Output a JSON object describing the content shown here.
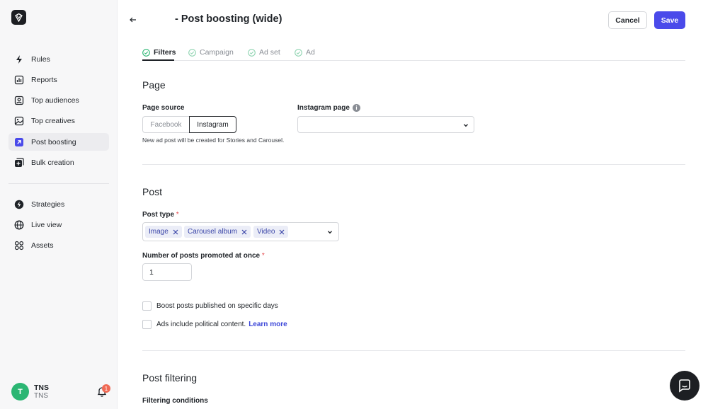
{
  "sidebar": {
    "items": [
      {
        "label": "Rules",
        "icon": "lightning-icon"
      },
      {
        "label": "Reports",
        "icon": "bar-chart-icon"
      },
      {
        "label": "Top audiences",
        "icon": "person-card-icon"
      },
      {
        "label": "Top creatives",
        "icon": "image-icon"
      },
      {
        "label": "Post boosting",
        "icon": "arrow-up-right-icon",
        "active": true
      },
      {
        "label": "Bulk creation",
        "icon": "stack-plus-icon"
      },
      {
        "label": "Strategies",
        "icon": "bolt-circle-icon"
      },
      {
        "label": "Live view",
        "icon": "globe-icon"
      },
      {
        "label": "Assets",
        "icon": "grid-icon"
      }
    ],
    "user": {
      "initial": "T",
      "name": "TNS",
      "sub": "TNS"
    },
    "notifications_count": "1"
  },
  "header": {
    "title": "- Post boosting (wide)",
    "cancel_label": "Cancel",
    "save_label": "Save"
  },
  "tabs": [
    {
      "label": "Filters",
      "active": true
    },
    {
      "label": "Campaign",
      "active": false
    },
    {
      "label": "Ad set",
      "active": false
    },
    {
      "label": "Ad",
      "active": false
    }
  ],
  "page_section": {
    "heading": "Page",
    "source_label": "Page source",
    "source_options": [
      "Facebook",
      "Instagram"
    ],
    "source_selected": "Instagram",
    "hint": "New ad post will be created for Stories and Carousel.",
    "instagram_label": "Instagram page",
    "instagram_value": ""
  },
  "post_section": {
    "heading": "Post",
    "type_label": "Post type",
    "required_mark": "*",
    "types": [
      "Image",
      "Carousel album",
      "Video"
    ],
    "count_label": "Number of posts promoted at once",
    "count_value": "1",
    "checkbox_boost": "Boost posts published on specific days",
    "checkbox_political": "Ads include political content.",
    "learn_more": "Learn more"
  },
  "filtering_section": {
    "heading": "Post filtering",
    "conditions_label": "Filtering conditions"
  },
  "colors": {
    "accent": "#4a4aea",
    "avatar": "#2bb673",
    "badge": "#f06a55"
  }
}
